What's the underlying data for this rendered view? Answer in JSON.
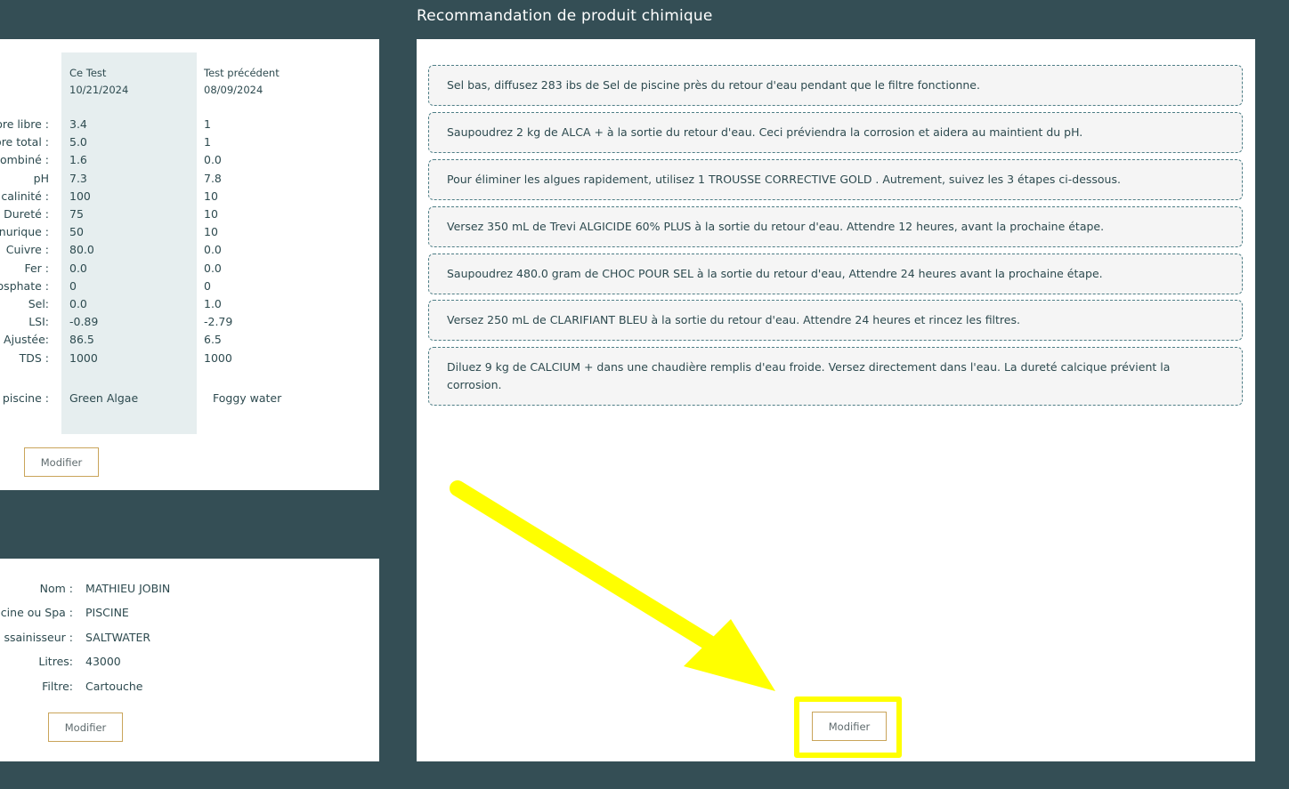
{
  "reco_title": "Recommandation de produit chimique",
  "test": {
    "current_header": {
      "label": "Ce Test",
      "date": "10/21/2024"
    },
    "previous_header": {
      "label": "Test précédent",
      "date": "08/09/2024"
    },
    "rows": [
      {
        "label": "ore libre :",
        "current": "3.4",
        "previous": "1"
      },
      {
        "label": "ore total :",
        "current": "5.0",
        "previous": "1"
      },
      {
        "label": "ombiné :",
        "current": "1.6",
        "previous": "0.0"
      },
      {
        "label": "pH",
        "current": "7.3",
        "previous": "7.8"
      },
      {
        "label": "calinité :",
        "current": "100",
        "previous": "10"
      },
      {
        "label": "Dureté :",
        "current": "75",
        "previous": "10"
      },
      {
        "label": "nurique :",
        "current": "50",
        "previous": "10"
      },
      {
        "label": "Cuivre :",
        "current": "80.0",
        "previous": "0.0"
      },
      {
        "label": "Fer :",
        "current": "0.0",
        "previous": "0.0"
      },
      {
        "label": "osphate :",
        "current": "0",
        "previous": "0"
      },
      {
        "label": "Sel:",
        "current": "0.0",
        "previous": "1.0"
      },
      {
        "label": "LSI:",
        "current": "-0.89",
        "previous": "-2.79"
      },
      {
        "label": "Ajustée:",
        "current": "86.5",
        "previous": "6.5"
      },
      {
        "label": "TDS :",
        "current": "1000",
        "previous": "1000"
      }
    ],
    "pool_state": {
      "label": "piscine :",
      "current": "Green Algae",
      "previous": "Foggy water"
    },
    "modify_label": "Modifier"
  },
  "client": {
    "fields": [
      {
        "label": "Nom :",
        "value": "MATHIEU JOBIN"
      },
      {
        "label": "cine ou Spa :",
        "value": "PISCINE"
      },
      {
        "label": "ssainisseur :",
        "value": "SALTWATER"
      },
      {
        "label": "Litres:",
        "value": "43000"
      },
      {
        "label": "Filtre:",
        "value": "Cartouche"
      }
    ],
    "modify_label": "Modifier"
  },
  "recommendations": {
    "items": [
      "Sel bas, diffusez 283 ibs de Sel de piscine près du retour d'eau pendant que le filtre fonctionne.",
      "Saupoudrez 2 kg de ALCA + à la sortie du retour d'eau. Ceci préviendra la corrosion et aidera au maintient du pH.",
      "Pour éliminer les algues rapidement, utilisez 1 TROUSSE CORRECTIVE GOLD . Autrement, suivez les 3 étapes ci-dessous.",
      "Versez 350 mL de Trevi ALGICIDE 60% PLUS à la sortie du retour d'eau. Attendre 12 heures, avant la prochaine étape.",
      "Saupoudrez 480.0 gram de CHOC POUR SEL à la sortie du retour d'eau, Attendre 24 heures avant la prochaine étape.",
      "Versez 250 mL de CLARIFIANT BLEU à la sortie du retour d'eau. Attendre 24 heures et rincez les filtres.",
      "Diluez 9 kg de CALCIUM + dans une chaudière remplis d'eau froide. Versez directement dans l'eau. La dureté calcique prévient la corrosion."
    ],
    "modify_label": "Modifier"
  },
  "annotation": {
    "arrow_color": "#ffff00",
    "highlight_color": "#ffff00"
  }
}
